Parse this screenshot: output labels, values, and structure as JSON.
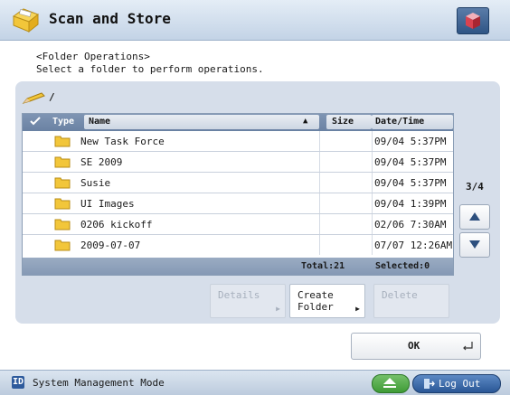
{
  "app": {
    "title": "Scan and Store",
    "icon": "folder-scan-icon"
  },
  "header": {
    "line1": "<Folder Operations>",
    "line2": "Select a folder to perform operations."
  },
  "path": "/",
  "table": {
    "columns": {
      "type": "Type",
      "name": "Name",
      "size": "Size",
      "date": "Date/Time"
    },
    "sort_indicator": "▲",
    "rows": [
      {
        "name": "New Task Force",
        "date": "09/04 5:37PM"
      },
      {
        "name": "SE 2009",
        "date": "09/04 5:37PM"
      },
      {
        "name": "Susie",
        "date": "09/04 5:37PM"
      },
      {
        "name": "UI Images",
        "date": "09/04 1:39PM"
      },
      {
        "name": "0206 kickoff",
        "date": "02/06 7:30AM"
      },
      {
        "name": "2009-07-07",
        "date": "07/07 12:26AM"
      }
    ],
    "total": "Total:21",
    "selected": "Selected:0"
  },
  "pager": {
    "page": "3/4"
  },
  "actions": {
    "details": "Details",
    "create_folder_1": "Create",
    "create_folder_2": "Folder",
    "delete": "Delete"
  },
  "ok": "OK",
  "status": {
    "mode": "System Management Mode",
    "mode_icon_letter": "ID",
    "logout": "Log Out"
  },
  "colors": {
    "folder": "#f2c63a",
    "accent": "#2a5796",
    "eject": "#3f9b37"
  }
}
